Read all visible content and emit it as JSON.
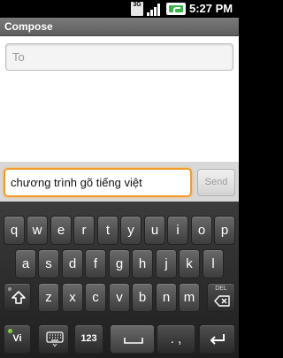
{
  "status_bar": {
    "network": "3G",
    "time": "5:27 PM",
    "icons": [
      "3g-icon",
      "signal-icon",
      "battery-charging-icon"
    ]
  },
  "title_bar": {
    "title": "Compose"
  },
  "compose": {
    "to_placeholder": "To"
  },
  "message": {
    "value": "chương trình gõ tiếng việt",
    "send_label": "Send"
  },
  "keyboard": {
    "row1": [
      "q",
      "w",
      "e",
      "r",
      "t",
      "y",
      "u",
      "i",
      "o",
      "p"
    ],
    "row2": [
      "a",
      "s",
      "d",
      "f",
      "g",
      "h",
      "j",
      "k",
      "l"
    ],
    "row3": [
      "z",
      "x",
      "c",
      "v",
      "b",
      "n",
      "m"
    ],
    "delete_label": "DEL",
    "language_label": "Vi",
    "numbers_label": "123",
    "punct_label": ". ,",
    "icons": [
      "shift-icon",
      "delete-icon",
      "keyboard-settings-icon",
      "space-icon",
      "enter-icon"
    ]
  }
}
